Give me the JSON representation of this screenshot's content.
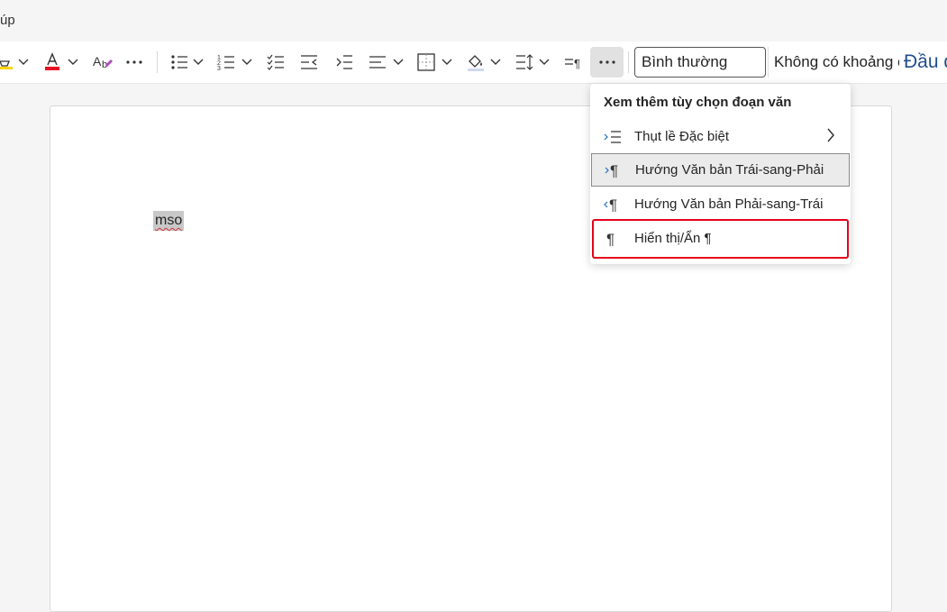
{
  "menu": {
    "help_tab_partial": "úp"
  },
  "toolbar": {
    "buttons": [
      "highlight-color",
      "font-color",
      "clear-formatting",
      "more-font",
      "bullets",
      "numbering",
      "checklist",
      "decrease-indent",
      "increase-indent",
      "align",
      "borders",
      "shading",
      "line-spacing",
      "paragraph-spacing",
      "more-paragraph"
    ],
    "font_color_accent": "#e81123",
    "highlight_accent": "#ffd400",
    "styles": {
      "normal": "Bình thường",
      "no_spacing": "Không có khoảng cách",
      "heading_partial": "Đầu đ"
    }
  },
  "document": {
    "text": "mso"
  },
  "paragraph_menu": {
    "title": "Xem thêm tùy chọn đoạn văn",
    "items": [
      {
        "icon": "special-indent-icon",
        "label": "Thụt lề Đặc biệt",
        "has_submenu": true
      },
      {
        "icon": "ltr-paragraph-icon",
        "label": "Hướng Văn bản Trái-sang-Phải",
        "selected": true
      },
      {
        "icon": "rtl-paragraph-icon",
        "label": "Hướng Văn bản Phải-sang-Trái"
      },
      {
        "icon": "pilcrow-icon",
        "label": "Hiển thị/Ẩn ¶",
        "highlighted": true
      }
    ],
    "highlight_color": "#e5001a"
  }
}
